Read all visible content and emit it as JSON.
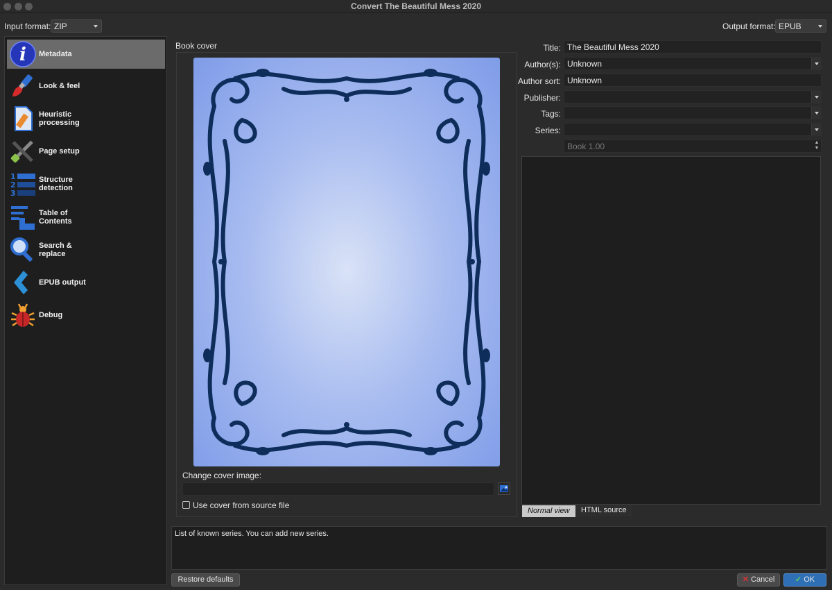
{
  "window": {
    "title": "Convert The Beautiful Mess 2020"
  },
  "toolbar": {
    "input_format_label": "Input format:",
    "input_format_value": "ZIP",
    "output_format_label": "Output format:",
    "output_format_value": "EPUB"
  },
  "sidebar": {
    "items": [
      {
        "label": "Metadata",
        "icon": "info-icon"
      },
      {
        "label": "Look & feel",
        "icon": "paintbrush-icon"
      },
      {
        "label": "Heuristic\nprocessing",
        "icon": "document-edit-icon"
      },
      {
        "label": "Page setup",
        "icon": "tools-icon"
      },
      {
        "label": "Structure\ndetection",
        "icon": "numbered-list-icon"
      },
      {
        "label": "Table of\nContents",
        "icon": "toc-icon"
      },
      {
        "label": "Search &\nreplace",
        "icon": "magnifier-icon"
      },
      {
        "label": "EPUB output",
        "icon": "epub-icon"
      },
      {
        "label": "Debug",
        "icon": "bug-icon"
      }
    ],
    "selected": "Metadata"
  },
  "cover": {
    "heading": "Book cover",
    "change_label": "Change cover image:",
    "path_value": "",
    "use_source_label": "Use cover from source file",
    "use_source_checked": false
  },
  "metadata": {
    "title_label": "Title:",
    "title_value": "The Beautiful Mess 2020",
    "authors_label": "Author(s):",
    "authors_value": "Unknown",
    "author_sort_label": "Author sort:",
    "author_sort_value": "Unknown",
    "publisher_label": "Publisher:",
    "publisher_value": "",
    "tags_label": "Tags:",
    "tags_value": "",
    "series_label": "Series:",
    "series_value": "",
    "series_index_value": "Book 1.00"
  },
  "editor": {
    "tab_normal": "Normal view",
    "tab_html": "HTML source",
    "active_tab": "Normal view"
  },
  "help_text": "List of known series. You can add new series.",
  "buttons": {
    "restore": "Restore defaults",
    "cancel": "Cancel",
    "ok": "OK"
  },
  "colors": {
    "accent": "#2f6fb5",
    "cover_frame": "#0e2d5a",
    "cover_bg_center": "#d9e2f6",
    "cover_bg_edge": "#7f9ce8"
  }
}
